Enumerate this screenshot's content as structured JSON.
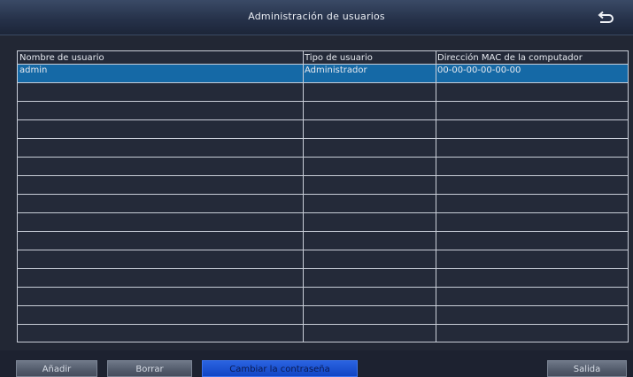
{
  "window": {
    "title": "Administración de usuarios"
  },
  "table": {
    "columns": [
      "Nombre de usuario",
      "Tipo de usuario",
      "Dirección MAC de la computador"
    ],
    "rows": [
      [
        "admin",
        "Administrador",
        "00-00-00-00-00-00"
      ]
    ],
    "selected_row": 0
  },
  "buttons": {
    "add": "Añadir",
    "delete": "Borrar",
    "change_password": "Cambiar la contraseña",
    "exit": "Salida"
  },
  "colors": {
    "selected_row": "#1569a6",
    "active_button": "#1f55d8",
    "grid_lines": "#c9ced8"
  },
  "icons": {
    "back": "return-arrow-icon"
  }
}
